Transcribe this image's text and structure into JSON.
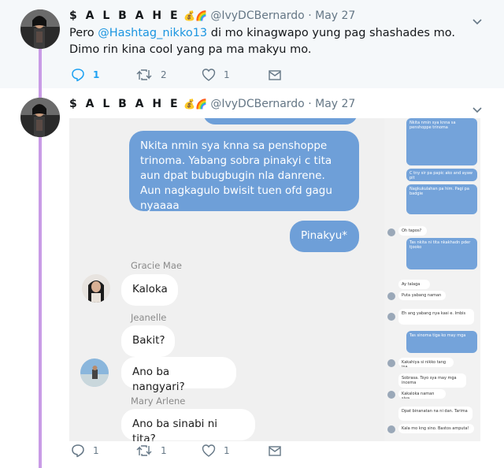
{
  "tweets": [
    {
      "display_name": "$ A L B A H E",
      "name_emojis": [
        "💰",
        "🌈"
      ],
      "handle": "@IvyDCBernardo",
      "separator": "·",
      "date": "May 27",
      "text_before": "Pero ",
      "mention": "@Hashtag_nikko13",
      "text_after": "  di mo kinagwapo yung pag shashades mo. Dimo rin kina cool yang pa ma makyu mo.",
      "reply_count": "1",
      "retweet_count": "2",
      "like_count": "1"
    },
    {
      "display_name": "$ A L B A H E",
      "name_emojis": [
        "💰",
        "🌈"
      ],
      "handle": "@IvyDCBernardo",
      "separator": "·",
      "date": "May 27",
      "reply_count": "1",
      "retweet_count": "1",
      "like_count": "1"
    }
  ],
  "screenshot": {
    "messages": {
      "m1": "Nkita nmin sya knna sa penshoppe trinoma. Yabang sobra pinakyi c tita aun dpat bubugbugin nla danrene. Aun nagkagulo bwisit tuen ofd gagu nyaaaa",
      "m2": "Pinakyu*",
      "m3_sender": "Gracie Mae",
      "m3": "Kaloka",
      "m4_sender": "Jeanelle",
      "m4": "Bakit?",
      "m5": "Ano ba nangyari?",
      "m6_sender": "Mary Arlene",
      "m6": "Ano ba sinabi ni tita?"
    },
    "side": {
      "b1": "Nkita nmin sya knna sa penshoppe trinoma",
      "b2": "C tny sir pa papic ako and ayaw pit",
      "b3": "Nagkukulahan pa him. Pagi pa badgie",
      "r1": "Oh tapos?",
      "b4": "Tas nkita ni tita nkakhadn pder tjooko",
      "r2": "Ay talaga",
      "r3": "Puta yabang naman",
      "r4": "Eh ang yabang nya kasi e. Imbis",
      "b5": "Tas sinoma tiga ko may mga",
      "r5": "Kakahiya si nikko tang ina",
      "r6": "Sobrasa. Tsyo sya may mga incema",
      "r7": "Kakaloka naman siya",
      "r8": "Dpat binanatan na ni dan. Tarima",
      "r9": "Kala mo kng sino. Bastos amputa!"
    }
  }
}
